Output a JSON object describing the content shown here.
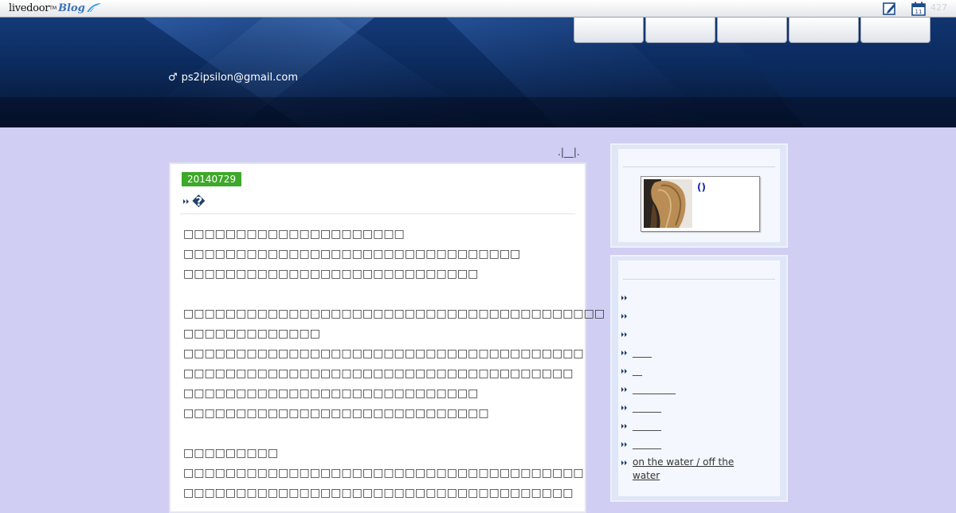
{
  "topbar": {
    "logo_word": "livedoor",
    "logo_tm": "TM",
    "logo_blog": "Blog",
    "count": "427"
  },
  "header": {
    "nav_tabs": [
      "",
      "",
      "",
      "",
      ""
    ],
    "author_symbol": "♂",
    "author_email": "ps2ipsilon@gmail.com"
  },
  "main": {
    "crumbs": ".|__|.",
    "post": {
      "date": "20140729",
      "title": "�",
      "lines": [
        "□□□□□□□□□□□□□□□□□□□□□",
        "□□□□□□□□□□□□□□□□□□□□□□□□□□□□□□□□",
        "□□□□□□□□□□□□□□□□□□□□□□□□□□□□",
        "",
        "□□□□□□□□□□□□□□□□□□□□□□□□□□□□□□□□□□□□□□□□",
        "□□□□□□□□□□□□□",
        "□□□□□□□□□□□□□□□□□□□□□□□□□□□□□□□□□□□□□□",
        "□□□□□□□□□□□□□□□□□□□□□□□□□□□□□□□□□□□□□",
        "□□□□□□□□□□□□□□□□□□□□□□□□□□□□",
        "□□□□□□□□□□□□□□□□□□□□□□□□□□□□□",
        "",
        "□□□□□□□□□",
        "□□□□□□□□□□□□□□□□□□□□□□□□□□□□□□□□□□□□□□",
        "□□□□□□□□□□□□□□□□□□□□□□□□□□□□□□□□□□□□□"
      ]
    }
  },
  "sidebar": {
    "profile": {
      "name": "()"
    },
    "categories": [
      "",
      "",
      "",
      "____",
      "__",
      "_________",
      "______",
      "______",
      "______",
      "on the water / off the water"
    ]
  }
}
